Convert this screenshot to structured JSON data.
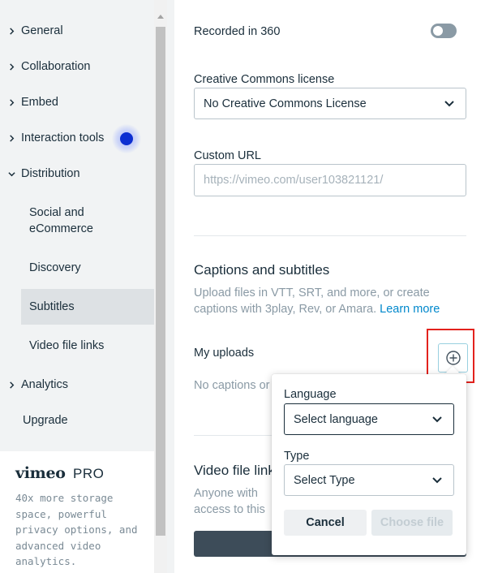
{
  "sidebar": {
    "items": [
      {
        "label": "General",
        "expanded": false
      },
      {
        "label": "Collaboration",
        "expanded": false
      },
      {
        "label": "Embed",
        "expanded": false
      },
      {
        "label": "Interaction tools",
        "expanded": false
      },
      {
        "label": "Distribution",
        "expanded": true
      },
      {
        "label": "Analytics",
        "expanded": false
      },
      {
        "label": "Upgrade"
      }
    ],
    "sub_items": [
      {
        "label": "Social and eCommerce"
      },
      {
        "label": "Discovery"
      },
      {
        "label": "Subtitles",
        "selected": true
      },
      {
        "label": "Video file links"
      }
    ],
    "promo": {
      "logo_text": "vimeo",
      "logo_suffix": "PRO",
      "text": "40x more storage space, powerful privacy options, and advanced video analytics."
    }
  },
  "main": {
    "recorded_360": {
      "label": "Recorded in 360",
      "enabled": false
    },
    "license": {
      "label": "Creative Commons license",
      "value": "No Creative Commons License"
    },
    "custom_url": {
      "label": "Custom URL",
      "value": "",
      "placeholder": "https://vimeo.com/user103821121/"
    },
    "captions": {
      "title": "Captions and subtitles",
      "desc": "Upload files in VTT, SRT, and more, or create captions with 3play, Rev, or Amara.",
      "link": "Learn more",
      "uploads_label": "My uploads",
      "empty_text": "No captions or subtitles"
    },
    "video_links": {
      "title": "Video file links",
      "desc": "Anyone with access to this video can view and download"
    }
  },
  "popover": {
    "language_label": "Language",
    "language_value": "Select language",
    "type_label": "Type",
    "type_value": "Select Type",
    "cancel_label": "Cancel",
    "choose_label": "Choose file"
  },
  "colors": {
    "sidebar_bg": "#f1f3f4",
    "selected_bg": "#dde1e4",
    "text": "#1a2e3b",
    "muted": "#8a9aa5",
    "link": "#0088cc",
    "highlight": "#e3221d",
    "focus_dot": "#0d2fd1"
  }
}
